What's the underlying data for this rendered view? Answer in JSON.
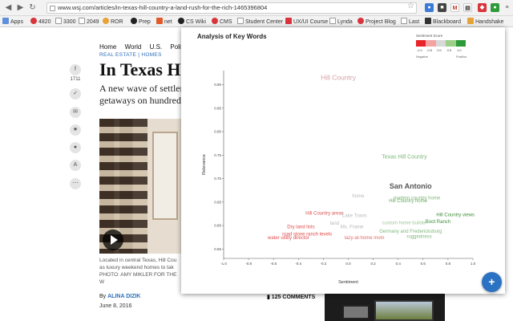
{
  "browser": {
    "url": "www.wsj.com/articles/in-texas-hill-country-a-land-rush-for-the-rich-1465396804",
    "bookmarks": [
      "Apps",
      "4820",
      "3300",
      "2049",
      "ROR",
      "Prep",
      "net",
      "CS Wiki",
      "CMS",
      "Student Center",
      "UX/UI Course",
      "Lynda",
      "Project Blog",
      "Last",
      "Blackboard",
      "Handshake"
    ]
  },
  "article": {
    "nav": [
      "Home",
      "World",
      "U.S.",
      "Politi"
    ],
    "section": "REAL ESTATE | HOMES",
    "headline": "In Texas Hi",
    "dek": "A new wave of settler getaways on hundred",
    "share_count": "1711",
    "caption": "Located in central Texas, Hill Cou as luxury weekend homes to tak PHOTO: AMY MIKLER FOR THE W",
    "byline_prefix": "By",
    "byline_author": "ALINA DIZIK",
    "date": "June 8, 2016",
    "comments": "125 COMMENTS"
  },
  "panel": {
    "title": "Analysis of Key Words",
    "fab_label": "+"
  },
  "chart_data": {
    "type": "scatter",
    "title": "Analysis of Key Words",
    "xlabel": "Sentiment",
    "ylabel": "Relevance",
    "xlim": [
      -1.0,
      1.0
    ],
    "ylim": [
      0.53,
      0.93
    ],
    "x_ticks": [
      "-1.0",
      "-0.8",
      "-0.6",
      "-0.4",
      "-0.2",
      "0.0",
      "0.2",
      "0.4",
      "0.6",
      "0.8",
      "1.0"
    ],
    "y_ticks": [
      "0.55",
      "0.60",
      "0.65",
      "0.70",
      "0.75",
      "0.80",
      "0.85",
      "0.90"
    ],
    "legend": {
      "title": "Sentiment Score",
      "values": [
        "-1.0",
        "-0.5",
        "0.0",
        "0.5",
        "1.0"
      ],
      "colors": [
        "#e8242a",
        "#f4a3a3",
        "#d9d9d9",
        "#9ccf8a",
        "#2e9a3a"
      ],
      "negative_label": "Negative",
      "positive_label": "Positive"
    },
    "points": [
      {
        "label": "Hill Country",
        "x": -0.08,
        "y": 0.91,
        "color": "#d9a0a4",
        "size": 8.5
      },
      {
        "label": "Texas Hill Country",
        "x": 0.45,
        "y": 0.743,
        "color": "#7fb879",
        "size": 7
      },
      {
        "label": "San Antonio",
        "x": 0.5,
        "y": 0.679,
        "color": "#555555",
        "size": 9,
        "bold": true
      },
      {
        "label": "home",
        "x": 0.08,
        "y": 0.66,
        "color": "#b8b8b8",
        "size": 6
      },
      {
        "label": "modern country home",
        "x": 0.55,
        "y": 0.656,
        "color": "#7fb879",
        "size": 6
      },
      {
        "label": "Hill Country home",
        "x": 0.48,
        "y": 0.65,
        "color": "#6aaa63",
        "size": 6
      },
      {
        "label": "Hill Country areas",
        "x": -0.19,
        "y": 0.623,
        "color": "#d95757",
        "size": 6
      },
      {
        "label": "Lake Travis",
        "x": 0.05,
        "y": 0.618,
        "color": "#b8b8b8",
        "size": 6
      },
      {
        "label": "Hill Country views",
        "x": 0.86,
        "y": 0.62,
        "color": "#3f8f3a",
        "size": 6
      },
      {
        "label": "Boot Ranch",
        "x": 0.72,
        "y": 0.605,
        "color": "#3f8f3a",
        "size": 6
      },
      {
        "label": "land",
        "x": -0.11,
        "y": 0.602,
        "color": "#b8b8b8",
        "size": 6
      },
      {
        "label": "custom home builder",
        "x": 0.45,
        "y": 0.603,
        "color": "#9fc99a",
        "size": 6
      },
      {
        "label": "Dry land lists",
        "x": -0.38,
        "y": 0.594,
        "color": "#e14b4b",
        "size": 6
      },
      {
        "label": "Ms. Frame",
        "x": 0.03,
        "y": 0.594,
        "color": "#b8b8b8",
        "size": 6
      },
      {
        "label": "Germany and Fredericksburg",
        "x": 0.5,
        "y": 0.585,
        "color": "#7fb879",
        "size": 6
      },
      {
        "label": "ruggedness",
        "x": 0.57,
        "y": 0.574,
        "color": "#7fb879",
        "size": 6
      },
      {
        "label": "road stone ranch levels",
        "x": -0.33,
        "y": 0.579,
        "color": "#e14b4b",
        "size": 6
      },
      {
        "label": "water utility director",
        "x": -0.48,
        "y": 0.571,
        "color": "#e14b4b",
        "size": 6
      },
      {
        "label": "lazy-at-home mom",
        "x": 0.13,
        "y": 0.571,
        "color": "#e06b6b",
        "size": 6
      }
    ]
  }
}
